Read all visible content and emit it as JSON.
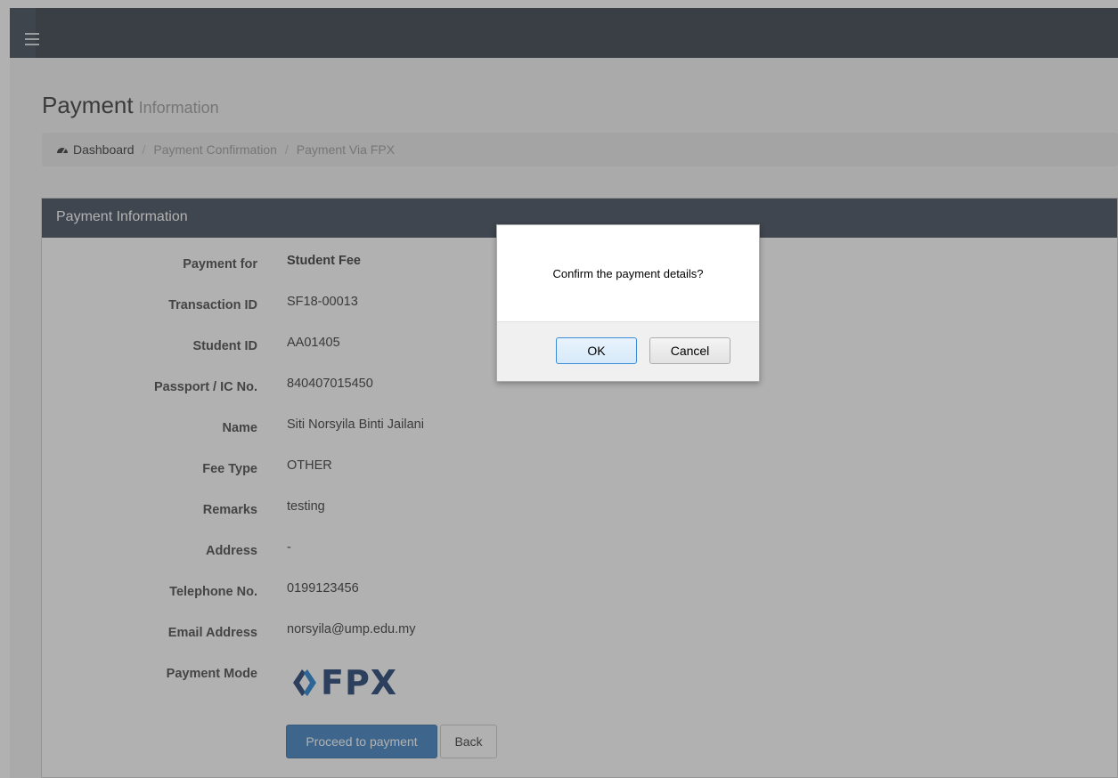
{
  "header": {
    "menu_icon": "hamburger-icon"
  },
  "page": {
    "title": "Payment",
    "subtitle": "Information"
  },
  "breadcrumb": {
    "home_icon": "dashboard-gauge-icon",
    "items": [
      "Dashboard",
      "Payment Confirmation",
      "Payment Via FPX"
    ],
    "separator": "/"
  },
  "panel": {
    "heading": "Payment Information",
    "fields": [
      {
        "label": "Payment for",
        "value": "Student Fee"
      },
      {
        "label": "Transaction ID",
        "value": "SF18-00013"
      },
      {
        "label": "Student ID",
        "value": "AA01405"
      },
      {
        "label": "Passport / IC No.",
        "value": "840407015450"
      },
      {
        "label": "Name",
        "value": "Siti Norsyila Binti Jailani"
      },
      {
        "label": "Fee Type",
        "value": "OTHER"
      },
      {
        "label": "Remarks",
        "value": "testing"
      },
      {
        "label": "Address",
        "value": "-"
      },
      {
        "label": "Telephone No.",
        "value": "0199123456"
      },
      {
        "label": "Email Address",
        "value": "norsyila@ump.edu.my"
      }
    ],
    "payment_mode_label": "Payment Mode",
    "payment_mode_logo": "FPX",
    "proceed_label": "Proceed to payment",
    "back_label": "Back"
  },
  "dialog": {
    "message": "Confirm the payment details?",
    "ok_label": "OK",
    "cancel_label": "Cancel"
  },
  "colors": {
    "topbar": "#323c48",
    "panel_heading": "#3c4856",
    "primary_button": "#3a7fc0",
    "fpx_blue": "#1b3c6e"
  }
}
